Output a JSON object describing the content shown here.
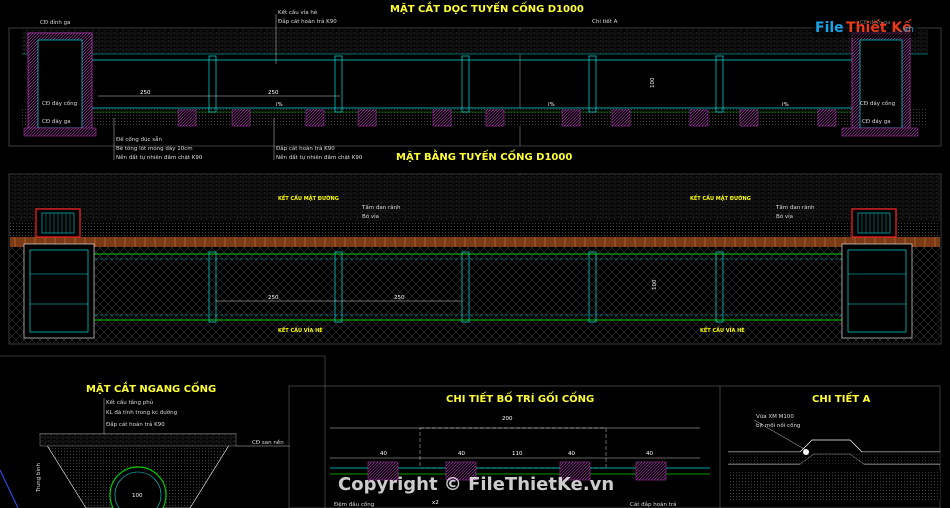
{
  "titles": {
    "longitudinal": "MẶT CẮT DỌC TUYẾN CỐNG D1000",
    "plan": "MẶT BẰNG TUYẾN CỐNG D1000",
    "cross": "MẶT CẮT NGANG CỐNG",
    "saddle": "CHI TIẾT BỐ TRÍ GỐI CỐNG",
    "detail_a": "CHI TIẾT A"
  },
  "long_labels": {
    "asphalt": "Kết cấu vỉa hè",
    "backfill_top": "Đắp cát hoàn trả K90",
    "detail_a": "Chi tiết A",
    "top_well_l": "CĐ đỉnh ga",
    "bottom_pipe_l": "CĐ đáy cống",
    "bottom_well_l": "CĐ đáy ga",
    "top_well_r": "CĐ đỉnh ga",
    "bottom_pipe_r": "CĐ đáy cống",
    "bottom_well_r": "CĐ đáy ga",
    "note1": "Đế cống đúc sẵn",
    "note2": "Bê tông lót móng dày 10cm",
    "note3": "Nền đất tự nhiên đầm chặt K90",
    "note4": "Đắp cát hoàn trả K90",
    "note5": "Nền đất tự nhiên đầm chặt K90",
    "dim1": "250",
    "dim2": "250",
    "slope1": "i%",
    "slope2": "i%",
    "slope3": "i%",
    "dim_v": "100"
  },
  "plan_labels": {
    "road1": "KẾT CẤU MẶT ĐƯỜNG",
    "road2": "KẾT CẤU MẶT ĐƯỜNG",
    "curb1": "Tấm đan rãnh",
    "curb1b": "Bó vỉa",
    "curb2": "Tấm đan rãnh",
    "curb2b": "Bó vỉa",
    "walk1": "KẾT CẤU VỈA HÈ",
    "walk2": "KẾT CẤU VỈA HÈ",
    "dim1": "250",
    "dim2": "250",
    "dim_v": "100"
  },
  "cross_labels": {
    "l1": "Kết cấu tầng phủ",
    "l2": "KL đá tính trong kc đường",
    "l3": "Đắp cát hoàn trả K90",
    "l4": "CĐ san nền",
    "l5": "Trung bình",
    "dia": "100"
  },
  "saddle_labels": {
    "top_dim": "200",
    "d1": "40",
    "d2": "40",
    "d3": "110",
    "d4": "40",
    "d5": "40",
    "bottom": "x2",
    "n1": "Đệm đầu cống",
    "n2": "Cát đắp hoàn trả"
  },
  "detail_a_labels": {
    "l1": "Vữa XM M100",
    "l2": "bịt mối nối cống"
  },
  "watermark": {
    "copyright": "Copyright © FileThietKe.vn",
    "logo_file": "File",
    "logo_thiet": "Thiết Kế",
    "logo_vn": ".vn"
  }
}
